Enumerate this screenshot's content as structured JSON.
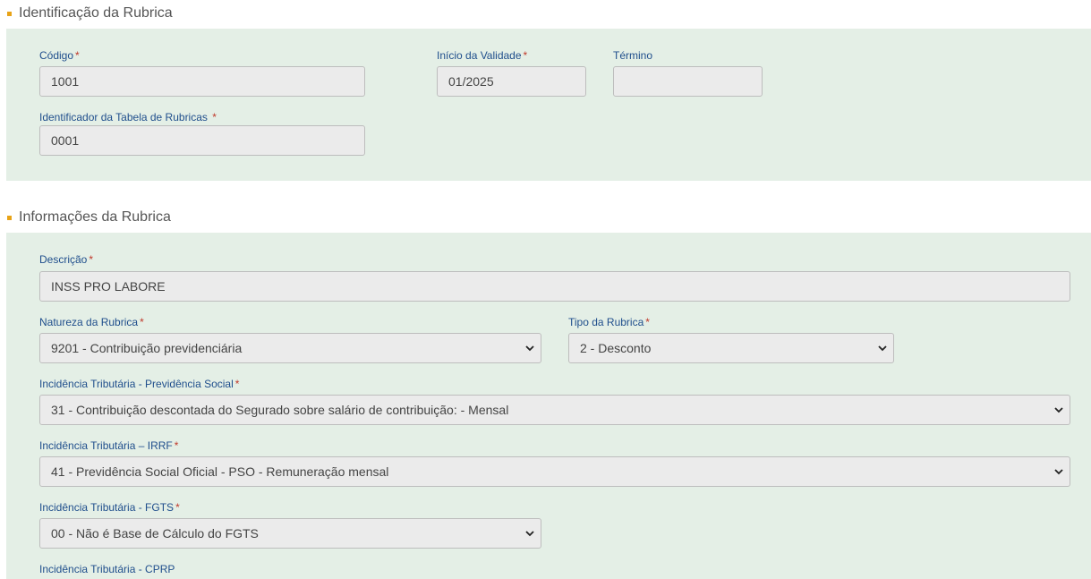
{
  "section1": {
    "title": "Identificação da Rubrica",
    "codigo": {
      "label": "Código",
      "value": "1001"
    },
    "inicio": {
      "label": "Início da Validade",
      "value": "01/2025"
    },
    "termino": {
      "label": "Término",
      "value": ""
    },
    "identificador": {
      "label": "Identificador da Tabela de Rubricas ",
      "value": "0001"
    }
  },
  "section2": {
    "title": "Informações da Rubrica",
    "descricao": {
      "label": "Descrição",
      "value": "INSS PRO LABORE"
    },
    "natureza": {
      "label": "Natureza da Rubrica",
      "value": "9201 - Contribuição previdenciária"
    },
    "tipo": {
      "label": "Tipo da Rubrica",
      "value": "2 - Desconto"
    },
    "inc_prev": {
      "label": "Incidência Tributária - Previdência Social",
      "value": "31 - Contribuição descontada do Segurado sobre salário de contribuição: - Mensal"
    },
    "inc_irrf": {
      "label": "Incidência Tributária – IRRF",
      "value": "41 - Previdência Social Oficial - PSO - Remuneração mensal"
    },
    "inc_fgts": {
      "label": "Incidência Tributária - FGTS",
      "value": "00 - Não é Base de Cálculo do FGTS"
    },
    "inc_cprp": {
      "label": "Incidência Tributária - CPRP"
    }
  },
  "required_marker": "*",
  "colors": {
    "panel": "#e4efe6",
    "label": "#1f4e8c",
    "required": "#c0392b",
    "bullet": "#e8a317"
  },
  "icons": {
    "dropdown": "chevron-down-icon"
  }
}
